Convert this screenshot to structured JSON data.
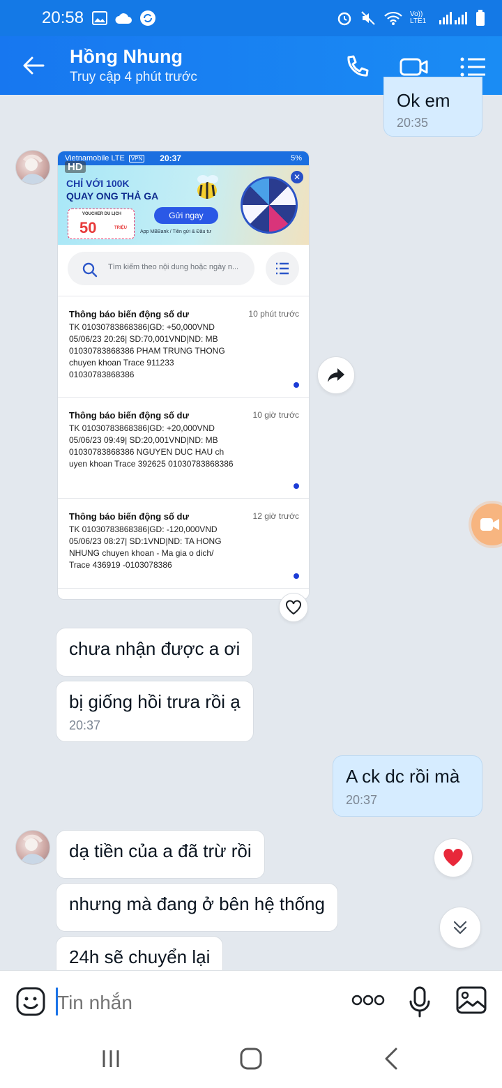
{
  "status_bar": {
    "time": "20:58",
    "network": "Vo)) LTE1"
  },
  "header": {
    "name": "Hồng Nhung",
    "status": "Truy cập 4 phút trước"
  },
  "messages": {
    "m1": {
      "text": "Ok em",
      "time": "20:35"
    },
    "m2": {
      "text": "chưa nhận được a ơi"
    },
    "m3": {
      "text": "bị giống hồi trưa rồi ạ",
      "time": "20:37"
    },
    "m4": {
      "text": "A ck dc rồi mà",
      "time": "20:37"
    },
    "m5": {
      "text": "dạ tiền của a đã trừ rồi"
    },
    "m6": {
      "text": "nhưng mà đang ở bên hệ thống"
    },
    "m7": {
      "text": "24h sẽ chuyển lại"
    }
  },
  "screenshot": {
    "status_left": "Vietnamobile  LTE",
    "status_vpn": "VPN",
    "status_time": "20:37",
    "status_battery": "5%",
    "hd": "HD",
    "banner": {
      "line1": "CHỈ VỚI 100K",
      "line2": "QUAY ONG THẢ GA",
      "voucher_label": "VOUCHER DU LỊCH",
      "voucher_value": "50",
      "voucher_unit": "TRIỆU",
      "cta": "Gửi ngay",
      "footnote": "App MBBank / Tiền gửi & Đầu tư"
    },
    "search_placeholder": "Tìm kiếm theo nội dung hoặc ngày n...",
    "notifications": [
      {
        "title": "Thông báo biến động số dư",
        "time": "10 phút trước",
        "body": "TK 01030783868386|GD: +50,000VND 05/06/23 20:26| SD:70,001VND|ND: MB 01030783868386 PHAM TRUNG THONG chuyen khoan Trace 911233 01030783868386"
      },
      {
        "title": "Thông báo biến động số dư",
        "time": "10 giờ trước",
        "body": "TK 01030783868386|GD: +20,000VND 05/06/23 09:49| SD:20,001VND|ND: MB 01030783868386 NGUYEN DUC HAU ch uyen khoan Trace 392625 01030783868386"
      },
      {
        "title": "Thông báo biến động số dư",
        "time": "12 giờ trước",
        "body": "TK 01030783868386|GD: -120,000VND 05/06/23 08:27| SD:1VND|ND: TA HONG NHUNG chuyen khoan - Ma gia o dich/ Trace 436919 -0103078386"
      }
    ]
  },
  "composer": {
    "placeholder": "Tin nhắn"
  },
  "icons": {
    "back": "arrow-left-icon",
    "call": "phone-icon",
    "video": "video-camera-icon",
    "menu": "list-menu-icon",
    "forward": "share-forward-icon",
    "heart": "heart-icon",
    "scroll_down": "chevron-double-down-icon",
    "emoji": "emoji-icon",
    "more": "more-dots-icon",
    "mic": "microphone-icon",
    "image": "image-icon"
  },
  "colors": {
    "header": "#1777f0",
    "my_bubble": "#d6ecff",
    "background": "#e3e8ee",
    "reaction": "#e8283a"
  }
}
